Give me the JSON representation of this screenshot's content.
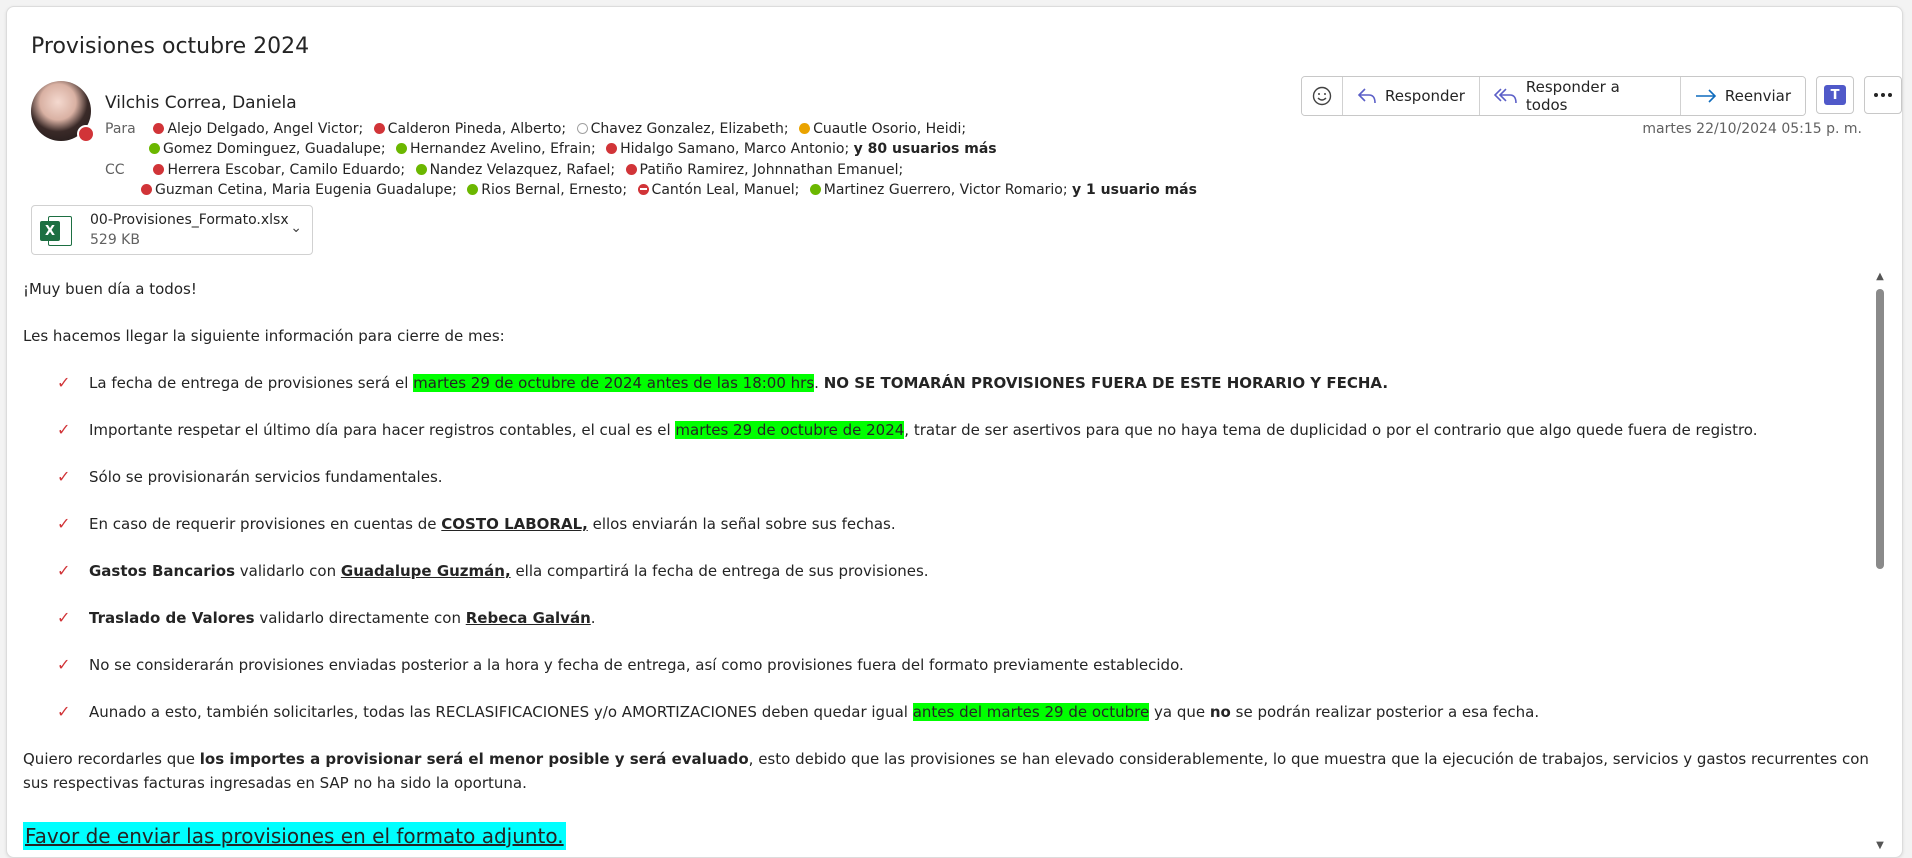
{
  "subject": "Provisiones octubre 2024",
  "sender": {
    "name": "Vilchis Correa, Daniela",
    "presence": "busy"
  },
  "to": {
    "label": "Para",
    "line1": [
      {
        "name": "Alejo Delgado, Angel Victor;",
        "status": "red"
      },
      {
        "name": "Calderon Pineda, Alberto;",
        "status": "red"
      },
      {
        "name": "Chavez Gonzalez, Elizabeth;",
        "status": "empty"
      },
      {
        "name": "Cuautle Osorio, Heidi;",
        "status": "yellow"
      }
    ],
    "line2": [
      {
        "name": "Gomez Dominguez, Guadalupe;",
        "status": "green"
      },
      {
        "name": "Hernandez Avelino, Efrain;",
        "status": "green"
      },
      {
        "name": "Hidalgo Samano, Marco Antonio;",
        "status": "red"
      }
    ],
    "more": "y 80 usuarios más"
  },
  "cc": {
    "label": "CC",
    "line1": [
      {
        "name": "Herrera Escobar, Camilo Eduardo;",
        "status": "red"
      },
      {
        "name": "Nandez Velazquez, Rafael;",
        "status": "green"
      },
      {
        "name": "Patiño Ramirez, Johnnathan Emanuel;",
        "status": "red"
      }
    ],
    "line2": [
      {
        "name": "Guzman Cetina, Maria Eugenia Guadalupe;",
        "status": "red"
      },
      {
        "name": "Rios Bernal, Ernesto;",
        "status": "green"
      },
      {
        "name": "Cantón Leal, Manuel;",
        "status": "minus"
      },
      {
        "name": "Martinez Guerrero, Victor Romario;",
        "status": "green"
      }
    ],
    "more": "y 1 usuario más"
  },
  "actions": {
    "reply": "Responder",
    "reply_all": "Responder a todos",
    "forward": "Reenviar"
  },
  "date": "martes 22/10/2024 05:15 p. m.",
  "attachment": {
    "name": "00-Provisiones_Formato.xlsx",
    "size": "529 KB"
  },
  "body": {
    "greeting": "¡Muy buen día a todos!",
    "intro": "Les hacemos llegar la siguiente información para cierre de mes:",
    "b1": {
      "pre": "La fecha de entrega de provisiones será el ",
      "hl": "martes 29 de octubre de 2024 antes de las 18:00 hrs",
      "post": ". ",
      "bold": "NO SE TOMARÁN PROVISIONES FUERA DE ESTE HORARIO Y FECHA."
    },
    "b2": {
      "pre": "Importante respetar el último día para hacer registros contables, el cual es el ",
      "hl": "martes 29 de octubre de 2024",
      "post": ", tratar de ser asertivos para que no haya tema de duplicidad o por el contrario que algo quede fuera de registro."
    },
    "b3": "Sólo se provisionarán servicios fundamentales.",
    "b4": {
      "pre": "En caso de requerir provisiones en cuentas de ",
      "u": "COSTO LABORAL,",
      "post": " ellos enviarán la señal sobre sus fechas."
    },
    "b5": {
      "bold": "Gastos Bancarios",
      "mid": " validarlo con ",
      "u": "Guadalupe Guzmán,",
      "post": " ella compartirá la fecha de entrega de sus provisiones."
    },
    "b6": {
      "bold": "Traslado de Valores",
      "mid": " validarlo directamente con ",
      "u": "Rebeca Galván",
      "post": "."
    },
    "b7": "No se considerarán provisiones enviadas posterior a la hora y fecha de entrega, así como provisiones fuera del formato previamente establecido.",
    "b8": {
      "pre": "Aunado a esto, también solicitarles, todas las RECLASIFICACIONES y/o AMORTIZACIONES deben quedar igual ",
      "hl": "antes del martes 29 de octubre",
      "mid": " ya que ",
      "bold": "no",
      "post": " se podrán realizar posterior a esa fecha."
    },
    "closing": {
      "pre": "Quiero recordarles que ",
      "bold": "los importes a provisionar será el menor posible y será evaluado",
      "post": ", esto debido que las provisiones se han elevado considerablemente, lo que muestra que la ejecución de trabajos, servicios y gastos recurrentes con sus respectivas facturas ingresadas en SAP no ha sido la oportuna."
    },
    "final": "Favor de enviar las provisiones en el formato adjunto."
  }
}
